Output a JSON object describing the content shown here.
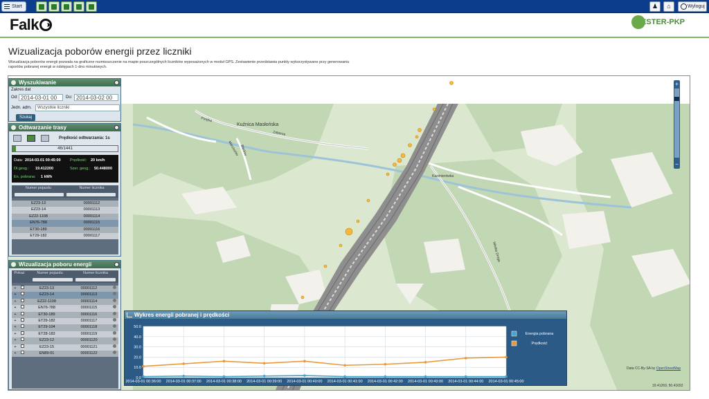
{
  "topbar": {
    "start_label": "Start",
    "logout_label": "Wyloguj",
    "toolbar_icons": [
      "app-icon-1",
      "app-icon-2",
      "app-icon-3",
      "app-icon-4",
      "app-icon-5"
    ]
  },
  "header": {
    "logo": "Falko",
    "partner_logo": "ELESTER-PKP"
  },
  "page": {
    "title": "Wizualizacja poborów energii przez liczniki",
    "description": "Wizualizacja poborów energii pozwala na graficzne rozmieszczenie na mapie poszczególnych liczników wyposażonych w moduł GPS. Zestawienie przedstawia punkty wykorzystywane przy generowaniu raportów pobranej energii w odstępach 1-dno minutowych."
  },
  "search_panel": {
    "title": "Wyszukiwanie",
    "date_range_label": "Zakres dat",
    "from_label": "Od:",
    "from_value": "2014-03-01 00",
    "to_label": "Do:",
    "to_value": "2014-03-02 00",
    "unit_label": "Jedn. adm.",
    "unit_value": "Wszystkie liczniki",
    "search_button": "Szukaj"
  },
  "replay_panel": {
    "title": "Odtwarzanie trasy",
    "speed_label": "Prędkość odtwarzania: 1s",
    "progress": "46/1441",
    "progress_fraction": 0.032,
    "info": {
      "date_label": "Data:",
      "date_value": "2014-03-01 00:45:00",
      "speed_label": "Prędkość:",
      "speed_value": "20 km/h",
      "lat_label": "Dł.geog.:",
      "lat_value": "19.412200",
      "lon_label": "Szer. geog.:",
      "lon_value": "50.448000",
      "energy_label": "En. pobrana:",
      "energy_value": "1 kWh"
    },
    "columns": [
      "Numer pojazdu",
      "Numer licznika"
    ],
    "rows": [
      [
        "EZ23-13",
        "00001112"
      ],
      [
        "EZ23-14",
        "00001113"
      ],
      [
        "EZ22-1108",
        "00001114"
      ],
      [
        "EN76-788",
        "00001115"
      ],
      [
        "ET30-189",
        "00001116"
      ],
      [
        "ET29-182",
        "00001117"
      ]
    ]
  },
  "visual_panel": {
    "title": "Wizualizacja poboru energii",
    "columns": [
      "Pokaż",
      "Numer pojazdu",
      "Numer licznika"
    ],
    "rows": [
      [
        "EZ23-13",
        "00001112"
      ],
      [
        "EZ23-14",
        "00001113"
      ],
      [
        "EZ22-1108",
        "00001114"
      ],
      [
        "EN76-788",
        "00001115"
      ],
      [
        "ET30-189",
        "00001116"
      ],
      [
        "ET29-182",
        "00001117"
      ],
      [
        "ET29-104",
        "00001118"
      ],
      [
        "ET28-183",
        "00001119"
      ],
      [
        "EZ23-12",
        "00001120"
      ],
      [
        "EZ23-15",
        "00001121"
      ],
      [
        "EN89-01",
        "00001122"
      ]
    ]
  },
  "map": {
    "labels": [
      "Kuźnica Masłońska",
      "Kazimierówka",
      "Poręba",
      "Zaborze",
      "Marciszów",
      "Błędów",
      "Wielka Droga"
    ],
    "attribution_prefix": "Data CC-By-SA by ",
    "attribution_link": "OpenStreetMap",
    "coords": "19.41269, 50.41692"
  },
  "chart_data": {
    "type": "line",
    "title": "Wykres energii pobranej i prędkości",
    "x": [
      "2014-03-01 00:36:00",
      "2014-03-01 00:37:00",
      "2014-03-01 00:38:00",
      "2014-03-01 00:39:00",
      "2014-03-01 00:40:00",
      "2014-03-01 00:41:00",
      "2014-03-01 00:42:00",
      "2014-03-01 00:43:00",
      "2014-03-01 00:44:00",
      "2014-03-01 00:45:00"
    ],
    "ylim": [
      0,
      50
    ],
    "yticks": [
      "50.0",
      "40.0",
      "30.0",
      "20.0",
      "10.0",
      "0.0"
    ],
    "series": [
      {
        "name": "Energia pobrana",
        "color": "#49a3c9",
        "values": [
          1,
          1.5,
          1,
          1.5,
          2,
          1,
          1,
          1,
          1,
          1
        ]
      },
      {
        "name": "Prędkość",
        "color": "#e89a36",
        "values": [
          11,
          13.5,
          16,
          14,
          16,
          12,
          13,
          15,
          19,
          20
        ]
      }
    ],
    "legend": "right"
  }
}
